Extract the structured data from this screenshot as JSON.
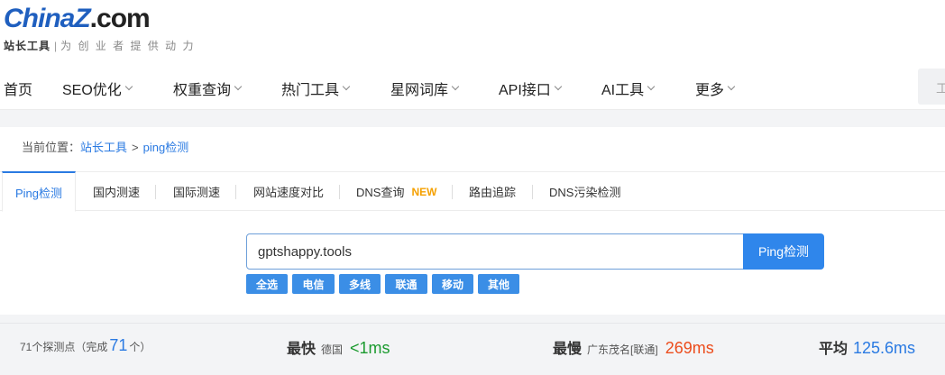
{
  "logo": {
    "china": "China",
    "z": "Z",
    "com": ".com",
    "name": "站长工具",
    "slogan": "为 创 业 者 提 供 动 力"
  },
  "nav": [
    {
      "label": "首页",
      "dropdown": false
    },
    {
      "label": "SEO优化",
      "dropdown": true
    },
    {
      "label": "权重查询",
      "dropdown": true
    },
    {
      "label": "热门工具",
      "dropdown": true
    },
    {
      "label": "星网词库",
      "dropdown": true
    },
    {
      "label": "API接口",
      "dropdown": true
    },
    {
      "label": "AI工具",
      "dropdown": true
    },
    {
      "label": "更多",
      "dropdown": true
    }
  ],
  "search_stub": "工",
  "breadcrumb": {
    "prefix": "当前位置：",
    "home": "站长工具",
    "separator": ">",
    "current": "ping检测"
  },
  "tabs": [
    {
      "label": "Ping检测",
      "active": true
    },
    {
      "label": "国内测速"
    },
    {
      "label": "国际测速"
    },
    {
      "label": "网站速度对比"
    },
    {
      "label": "DNS查询",
      "badge": "NEW"
    },
    {
      "label": "路由追踪"
    },
    {
      "label": "DNS污染检测"
    }
  ],
  "form": {
    "value": "gptshappy.tools",
    "button": "Ping检测"
  },
  "filters": [
    "全选",
    "电信",
    "多线",
    "联通",
    "移动",
    "其他"
  ],
  "stats": {
    "points_prefix": "71个探测点（完成",
    "completed": "71",
    "points_suffix": "个）",
    "fastest_label": "最快",
    "fastest_loc": "德国",
    "fastest_value": "<1ms",
    "slowest_label": "最慢",
    "slowest_loc": "广东茂名[联通]",
    "slowest_value": "269ms",
    "avg_label": "平均",
    "avg_value": "125.6ms"
  },
  "colors": {
    "accent": "#2a7ae2",
    "fast": "#1a9a2e",
    "slow": "#ec4c1c",
    "new_badge": "#f5a000"
  }
}
